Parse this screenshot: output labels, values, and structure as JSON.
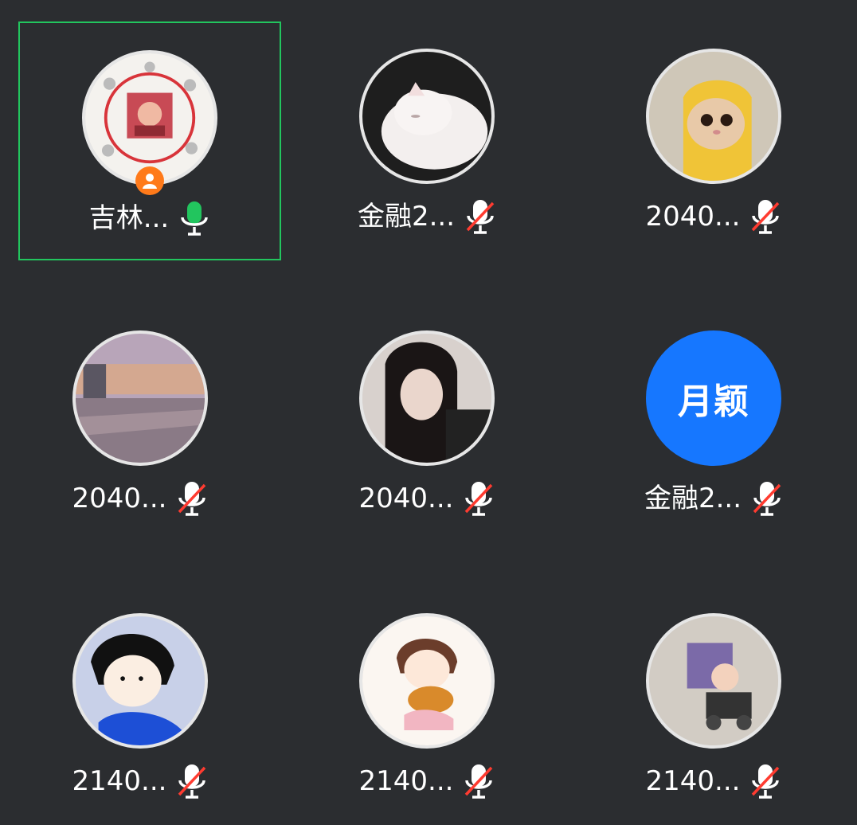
{
  "participants": [
    {
      "name": "吉林...",
      "mic": "on",
      "host": true,
      "active": true,
      "avatar": "collage-avatar"
    },
    {
      "name": "金融2...",
      "mic": "muted",
      "avatar": "sleeping-white-cat-avatar"
    },
    {
      "name": "2040...",
      "mic": "muted",
      "avatar": "yellow-hood-cat-avatar"
    },
    {
      "name": "2040...",
      "mic": "muted",
      "avatar": "sunset-campus-avatar"
    },
    {
      "name": "2040...",
      "mic": "muted",
      "avatar": "girl-portrait-avatar"
    },
    {
      "name": "金融2...",
      "mic": "muted",
      "avatar_text": "月颖",
      "avatar": "text-avatar"
    },
    {
      "name": "2140...",
      "mic": "muted",
      "avatar": "cartoon-girl-avatar"
    },
    {
      "name": "2140...",
      "mic": "muted",
      "avatar": "cartoon-girl-hug-avatar"
    },
    {
      "name": "2140...",
      "mic": "muted",
      "avatar": "baby-car-avatar"
    }
  ],
  "colors": {
    "background": "#2b2d30",
    "active_border": "#22c55e",
    "mic_on": "#22c55e",
    "muted_slash": "#ff3b30",
    "text_avatar_bg": "#1677ff",
    "host_badge": "#ff7a1a"
  }
}
